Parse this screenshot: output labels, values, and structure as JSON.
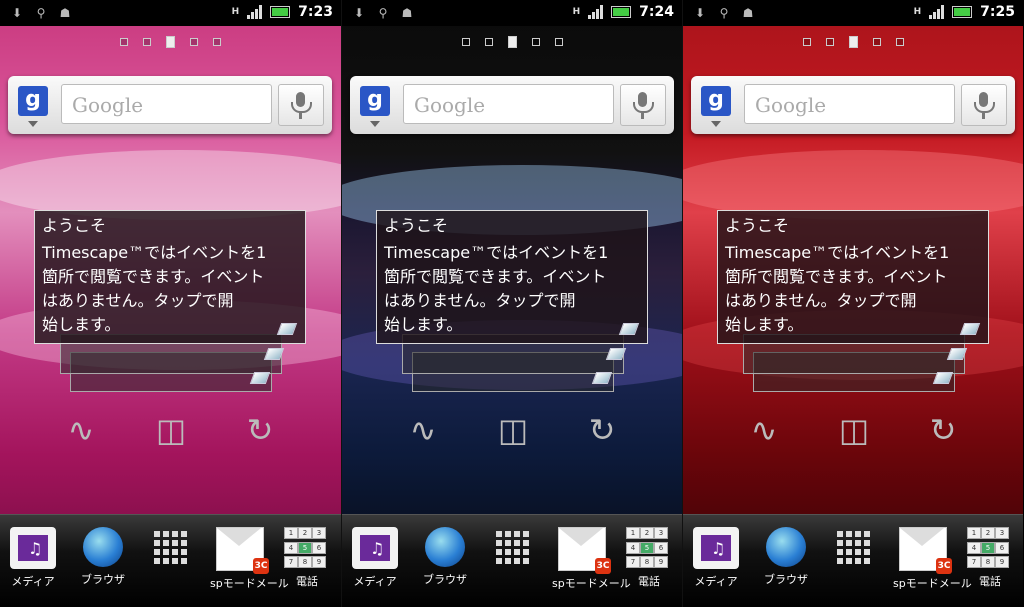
{
  "screens": [
    {
      "theme": "pink",
      "status": {
        "network": "H",
        "time": "7:23"
      },
      "search": {
        "placeholder": "Google"
      },
      "card": {
        "title": "ようこそ",
        "message": "Timescape™ではイベントを1\n箇所で閲覧できます。イベント\nはありません。タップで開\n始します。"
      },
      "dock": [
        {
          "label": "メディア",
          "icon": "media-icon"
        },
        {
          "label": "ブラウザ",
          "icon": "globe-icon"
        },
        {
          "label": "",
          "icon": "app-grid-icon"
        },
        {
          "label": "spモードメール",
          "icon": "mail-icon"
        },
        {
          "label": "電話",
          "icon": "phone-keypad-icon"
        }
      ]
    },
    {
      "theme": "black",
      "status": {
        "network": "H",
        "time": "7:24"
      },
      "search": {
        "placeholder": "Google"
      },
      "card": {
        "title": "ようこそ",
        "message": "Timescape™ではイベントを1\n箇所で閲覧できます。イベント\nはありません。タップで開\n始します。"
      },
      "dock": [
        {
          "label": "メディア",
          "icon": "media-icon"
        },
        {
          "label": "ブラウザ",
          "icon": "globe-icon"
        },
        {
          "label": "",
          "icon": "app-grid-icon"
        },
        {
          "label": "spモードメール",
          "icon": "mail-icon"
        },
        {
          "label": "電話",
          "icon": "phone-keypad-icon"
        }
      ]
    },
    {
      "theme": "red",
      "status": {
        "network": "H",
        "time": "7:25"
      },
      "search": {
        "placeholder": "Google"
      },
      "card": {
        "title": "ようこそ",
        "message": "Timescape™ではイベントを1\n箇所で閲覧できます。イベント\nはありません。タップで開\n始します。"
      },
      "dock": [
        {
          "label": "メディア",
          "icon": "media-icon"
        },
        {
          "label": "ブラウザ",
          "icon": "globe-icon"
        },
        {
          "label": "",
          "icon": "app-grid-icon"
        },
        {
          "label": "spモードメール",
          "icon": "mail-icon"
        },
        {
          "label": "電話",
          "icon": "phone-keypad-icon"
        }
      ]
    }
  ]
}
